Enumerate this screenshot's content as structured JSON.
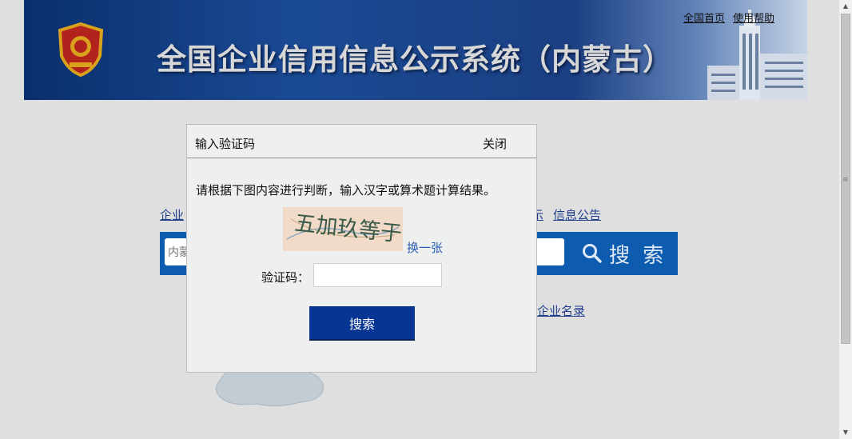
{
  "header": {
    "title": "全国企业信用信息公示系统（内蒙古）",
    "links": [
      "全国首页",
      "使用帮助"
    ]
  },
  "search": {
    "nav_left": "企业",
    "nav_right_1": "示",
    "nav_right_2": "信息公告",
    "placeholder": "内蒙",
    "button_label": "搜 索",
    "bottom_link": "企业名录"
  },
  "dialog": {
    "title": "输入验证码",
    "close_label": "关闭",
    "instruction": "请根据下图内容进行判断，输入汉字或算术题计算结果。",
    "captcha_text": "五加玖等于",
    "refresh_label": "换一张",
    "code_label": "验证码：",
    "code_value": "",
    "submit_label": "搜索"
  },
  "colors": {
    "header_blue": "#1a4a94",
    "search_bar_blue": "#0e5caf",
    "submit_blue": "#073593",
    "link_blue": "#2a5db6"
  }
}
